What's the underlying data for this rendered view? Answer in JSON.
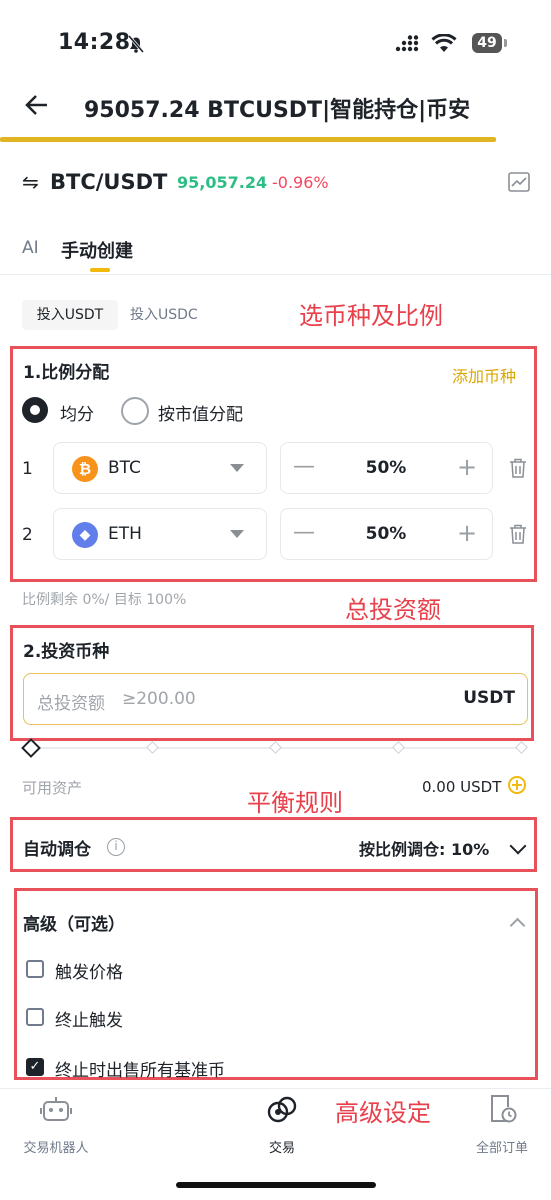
{
  "status": {
    "time": "14:28",
    "battery": "49"
  },
  "header": {
    "title": "95057.24 BTCUSDT|智能持仓|币安"
  },
  "pair": {
    "swap_icon": "⇋",
    "symbol": "BTC/USDT",
    "price": "95,057.24",
    "change": "-0.96%"
  },
  "tabs": [
    {
      "label": "AI"
    },
    {
      "label": "手动创建"
    }
  ],
  "invest_chips": [
    {
      "label": "投入USDT"
    },
    {
      "label": "投入USDC"
    }
  ],
  "annotations": {
    "select_coin": "选币种及比例",
    "total_amount": "总投资额",
    "balance_rule": "平衡规则",
    "advanced": "高级设定"
  },
  "allocation": {
    "title": "1.比例分配",
    "add_coin": "添加币种",
    "radio_equal": "均分",
    "radio_market": "按市值分配",
    "rows": [
      {
        "index": "1",
        "coin": "BTC",
        "percent": "50%",
        "color": "#f7931a",
        "glyph": "₿"
      },
      {
        "index": "2",
        "coin": "ETH",
        "percent": "50%",
        "color": "#627eea",
        "glyph": "◆"
      }
    ],
    "step_minus": "—",
    "step_plus": "+",
    "hint": "比例剩余 0%/ 目标 100%"
  },
  "investment": {
    "title": "2.投资币种",
    "placeholder": "总投资额",
    "min": "≥200.00",
    "unit": "USDT",
    "available_label": "可用资产",
    "available_value": "0.00 USDT"
  },
  "auto_rebalance": {
    "label": "自动调仓",
    "value": "按比例调仓: 10%"
  },
  "advanced": {
    "title": "高级（可选）",
    "options": [
      {
        "label": "触发价格",
        "checked": false
      },
      {
        "label": "终止触发",
        "checked": false
      },
      {
        "label": "终止时出售所有基准币",
        "checked": true
      }
    ]
  },
  "nav": [
    {
      "label": "交易机器人",
      "icon": "robot-icon"
    },
    {
      "label": "交易",
      "icon": "trade-icon"
    },
    {
      "label": "全部订单",
      "icon": "orders-icon"
    }
  ],
  "colors": {
    "accent": "#f0b90b",
    "up": "#2ebd85",
    "down": "#f6465d",
    "annotation": "#e8414b"
  }
}
